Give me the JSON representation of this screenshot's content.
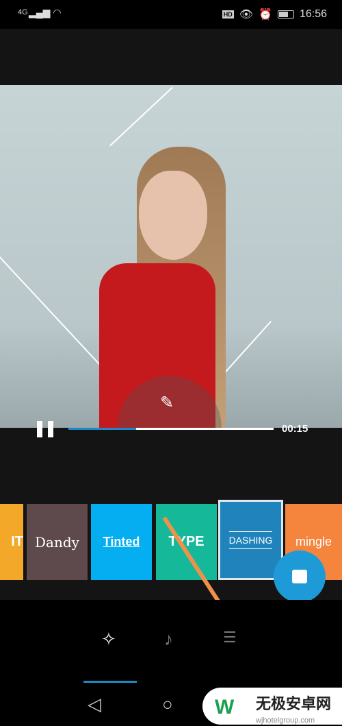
{
  "status": {
    "network": "4G",
    "time": "16:56",
    "hd": "HD"
  },
  "player": {
    "time": "00:15",
    "progress": 0.33
  },
  "themes": [
    {
      "label": "IT",
      "color": "#f4a82a"
    },
    {
      "label": "Dandy",
      "color": "#5e4a4c"
    },
    {
      "label": "Tinted",
      "color": "#04aef0"
    },
    {
      "label": "TYPE",
      "color": "#16b89a"
    },
    {
      "label": "DASHING",
      "color": "#2183bc",
      "selected": true
    },
    {
      "label": "mingle",
      "color": "#f5853d"
    }
  ],
  "tabs": [
    {
      "icon": "theme-sparkle-icon",
      "active": true
    },
    {
      "icon": "music-note-icon"
    },
    {
      "icon": "settings-sliders-icon"
    }
  ],
  "watermark": {
    "title": "无极安卓网",
    "url": "wjhotelgroup.com"
  }
}
